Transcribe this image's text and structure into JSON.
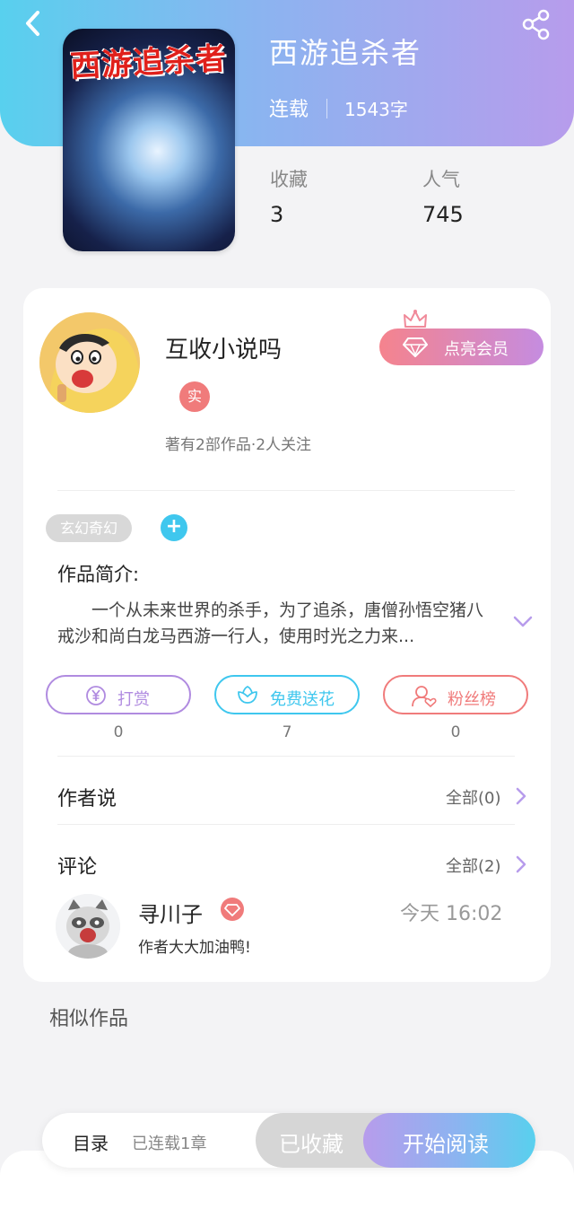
{
  "book": {
    "cover_title": "西游追杀者",
    "title": "西游追杀者",
    "status": "连载",
    "word_count": "1543字"
  },
  "stats": {
    "favorites_label": "收藏",
    "favorites_value": "3",
    "popularity_label": "人气",
    "popularity_value": "745"
  },
  "author": {
    "name": "互收小说吗",
    "badge": "实",
    "meta": "著有2部作品·2人关注",
    "vip_button": "点亮会员"
  },
  "tags": [
    "玄幻奇幻"
  ],
  "intro": {
    "label": "作品简介:",
    "text": "一个从未来世界的杀手，为了追杀，唐僧孙悟空猪八戒沙和尚白龙马西游一行人，使用时光之力来..."
  },
  "actions": [
    {
      "label": "打赏",
      "count": "0",
      "color": "#b08be0",
      "icon": "yen-icon"
    },
    {
      "label": "免费送花",
      "count": "7",
      "color": "#3fc7ee",
      "icon": "flower-icon"
    },
    {
      "label": "粉丝榜",
      "count": "0",
      "color": "#f07b7b",
      "icon": "fan-icon"
    }
  ],
  "author_says": {
    "title": "作者说",
    "link": "全部(0)"
  },
  "comments": {
    "title": "评论",
    "link": "全部(2)",
    "items": [
      {
        "name": "寻川子",
        "time": "今天 16:02",
        "text": "作者大大加油鸭!"
      }
    ]
  },
  "similar_label": "相似作品",
  "bottom_bar": {
    "toc_label": "目录",
    "toc_sub": "已连载1章",
    "fav_label": "已收藏",
    "read_label": "开始阅读"
  }
}
